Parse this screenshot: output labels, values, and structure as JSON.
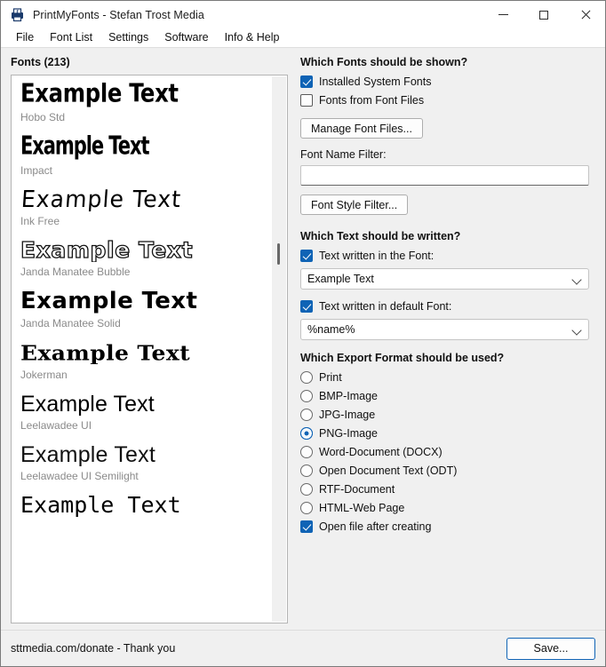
{
  "window": {
    "title": "PrintMyFonts - Stefan Trost Media",
    "app_icon": "printmyfonts-app-icon",
    "minimize_label": "Minimize",
    "maximize_label": "Maximize",
    "close_label": "Close"
  },
  "menubar": {
    "items": [
      {
        "label": "File"
      },
      {
        "label": "Font List"
      },
      {
        "label": "Settings"
      },
      {
        "label": "Software"
      },
      {
        "label": "Info & Help"
      }
    ]
  },
  "fonts_panel": {
    "title": "Fonts (213)",
    "sample_text": "Example Text",
    "entries": [
      {
        "sample": "Example Text",
        "name": "Hobo Std",
        "style": "s-hobo"
      },
      {
        "sample": "Example Text",
        "name": "Impact",
        "style": "s-impact"
      },
      {
        "sample": "Example Text",
        "name": "Ink Free",
        "style": "s-inkfree"
      },
      {
        "sample": "Example Text",
        "name": "Janda Manatee Bubble",
        "style": "s-bubble"
      },
      {
        "sample": "Example Text",
        "name": "Janda Manatee Solid",
        "style": "s-solid"
      },
      {
        "sample": "Example Text",
        "name": "Jokerman",
        "style": "s-jokerman"
      },
      {
        "sample": "Example Text",
        "name": "Leelawadee UI",
        "style": "s-leela"
      },
      {
        "sample": "Example Text",
        "name": "Leelawadee UI Semilight",
        "style": "s-leelalt"
      },
      {
        "sample": "Example Text",
        "name": "",
        "style": "s-mono"
      }
    ]
  },
  "which_fonts": {
    "heading": "Which Fonts should be shown?",
    "installed_system_fonts": {
      "label": "Installed System Fonts",
      "checked": true
    },
    "fonts_from_font_files": {
      "label": "Fonts from Font Files",
      "checked": false
    },
    "manage_button": "Manage Font Files...",
    "name_filter_label": "Font Name Filter:",
    "name_filter_value": "",
    "name_filter_placeholder": "",
    "style_filter_button": "Font Style Filter..."
  },
  "which_text": {
    "heading": "Which Text should be written?",
    "in_font": {
      "label": "Text written in the Font:",
      "checked": true,
      "value": "Example Text"
    },
    "in_default_font": {
      "label": "Text written in default Font:",
      "checked": true,
      "value": "%name%"
    }
  },
  "export_format": {
    "heading": "Which Export Format should be used?",
    "selected": "PNG-Image",
    "options": [
      {
        "label": "Print",
        "selected": false
      },
      {
        "label": "BMP-Image",
        "selected": false
      },
      {
        "label": "JPG-Image",
        "selected": false
      },
      {
        "label": "PNG-Image",
        "selected": true
      },
      {
        "label": "Word-Document (DOCX)",
        "selected": false
      },
      {
        "label": "Open Document Text (ODT)",
        "selected": false
      },
      {
        "label": "RTF-Document",
        "selected": false
      },
      {
        "label": "HTML-Web Page",
        "selected": false
      }
    ],
    "open_after_creating": {
      "label": "Open file after creating",
      "checked": true
    }
  },
  "statusbar": {
    "text": "sttmedia.com/donate - Thank you",
    "save_label": "Save..."
  },
  "colors": {
    "accent": "#0f63b5",
    "window_bg": "#f0f0f0",
    "list_bg": "#ffffff",
    "font_name_gray": "#8a8a8a"
  }
}
